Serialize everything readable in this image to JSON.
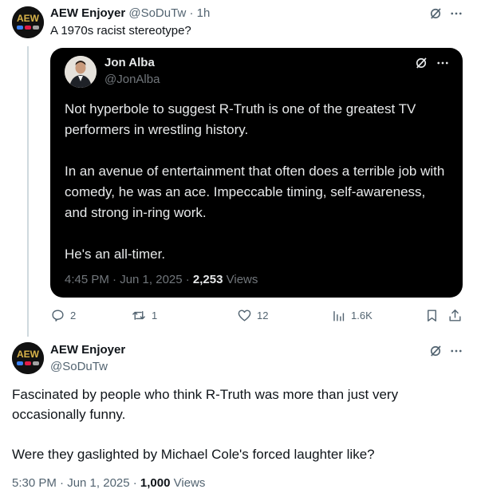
{
  "tweet1": {
    "display_name": "AEW Enjoyer",
    "handle_time": "@SoDuTw · 1h",
    "text": "A 1970s racist stereotype?",
    "avatar_text": "AEW"
  },
  "quote": {
    "display_name": "Jon Alba",
    "handle": "@JonAlba",
    "paragraphs": [
      "Not hyperbole to suggest R-Truth is one of the greatest TV performers in wrestling history.",
      "In an avenue of entertainment that often does a terrible job with comedy, he was an ace. Impeccable timing, self-awareness, and strong in-ring work.",
      "He's an all-timer."
    ],
    "time": "4:45 PM · Jun 1, 2025 · ",
    "views_count": "2,253",
    "views_label": " Views"
  },
  "actions": {
    "replies": "2",
    "reposts": "1",
    "likes": "12",
    "views": "1.6K"
  },
  "tweet2": {
    "display_name": "AEW Enjoyer",
    "handle": "@SoDuTw",
    "avatar_text": "AEW",
    "paragraphs": [
      "Fascinated by people who think R-Truth was more than just very occasionally funny.",
      "Were they gaslighted by Michael Cole's forced laughter like?"
    ],
    "time": "5:30 PM · Jun 1, 2025 · ",
    "views_count": "1,000",
    "views_label": " Views"
  },
  "colors": {
    "text": "#0f1419",
    "muted": "#536471",
    "card_bg": "#000000",
    "card_text": "#e7e9ea",
    "card_muted": "#71767b",
    "line": "#cfd9de"
  },
  "icons": [
    "grok-icon",
    "more-icon",
    "reply-icon",
    "repost-icon",
    "like-icon",
    "views-icon",
    "bookmark-icon",
    "share-icon"
  ]
}
